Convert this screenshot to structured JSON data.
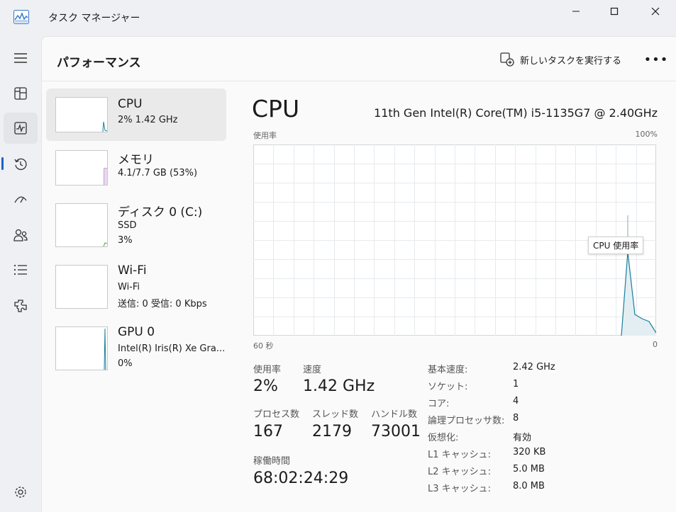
{
  "window": {
    "title": "タスク マネージャー"
  },
  "header": {
    "page_title": "パフォーマンス",
    "run_task_label": "新しいタスクを実行する",
    "more_label": "•••"
  },
  "nav": {
    "items": [
      {
        "name": "nav-hamburger",
        "icon": "menu-icon"
      },
      {
        "name": "nav-processes",
        "icon": "processes-icon"
      },
      {
        "name": "nav-performance",
        "icon": "performance-icon"
      },
      {
        "name": "nav-app-history",
        "icon": "history-icon"
      },
      {
        "name": "nav-startup",
        "icon": "startup-icon"
      },
      {
        "name": "nav-users",
        "icon": "users-icon"
      },
      {
        "name": "nav-details",
        "icon": "details-icon"
      },
      {
        "name": "nav-services",
        "icon": "services-icon"
      },
      {
        "name": "nav-settings",
        "icon": "settings-icon"
      }
    ]
  },
  "resources": [
    {
      "name": "CPU",
      "line1": "2%  1.42 GHz",
      "line2": "",
      "color": "#1a7f9c"
    },
    {
      "name": "メモリ",
      "line1": "4.1/7.7 GB (53%)",
      "line2": "",
      "color": "#8b3fa8"
    },
    {
      "name": "ディスク 0 (C:)",
      "line1": "SSD",
      "line2": "3%",
      "color": "#4aa546"
    },
    {
      "name": "Wi-Fi",
      "line1": "Wi-Fi",
      "line2": "送信: 0  受信: 0 Kbps",
      "color": "#a85c1a"
    },
    {
      "name": "GPU 0",
      "line1": "Intel(R) Iris(R) Xe Gra...",
      "line2": "0%",
      "color": "#1a7f9c"
    }
  ],
  "detail": {
    "title": "CPU",
    "model": "11th Gen Intel(R) Core(TM) i5-1135G7 @ 2.40GHz",
    "graph": {
      "label_top_left": "使用率",
      "label_top_right": "100%",
      "label_bottom_left": "60 秒",
      "label_bottom_right": "0",
      "tooltip": "CPU 使用率",
      "color": "#1a7f9c"
    },
    "stats": {
      "usage_label": "使用率",
      "usage_value": "2%",
      "speed_label": "速度",
      "speed_value": "1.42 GHz",
      "processes_label": "プロセス数",
      "processes_value": "167",
      "threads_label": "スレッド数",
      "threads_value": "2179",
      "handles_label": "ハンドル数",
      "handles_value": "73001",
      "uptime_label": "稼働時間",
      "uptime_value": "68:02:24:29"
    },
    "specs": [
      {
        "label": "基本速度:",
        "value": "2.42 GHz"
      },
      {
        "label": "ソケット:",
        "value": "1"
      },
      {
        "label": "コア:",
        "value": "4"
      },
      {
        "label": "論理プロセッサ数:",
        "value": "8"
      },
      {
        "label": "仮想化:",
        "value": "有効"
      },
      {
        "label": "L1 キャッシュ:",
        "value": "320 KB"
      },
      {
        "label": "L2 キャッシュ:",
        "value": "5.0 MB"
      },
      {
        "label": "L3 キャッシュ:",
        "value": "8.0 MB"
      }
    ]
  }
}
